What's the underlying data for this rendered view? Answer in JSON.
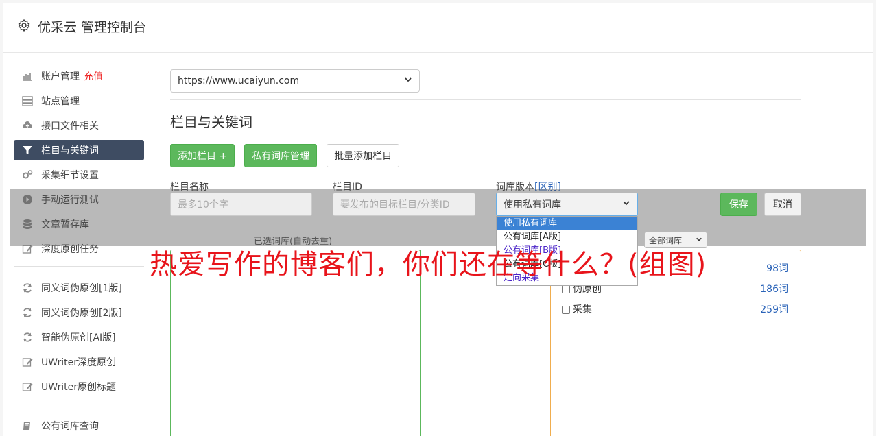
{
  "header": {
    "title": "优采云 管理控制台",
    "icon": "gear-icon"
  },
  "sidebar": {
    "items": [
      {
        "label": "账户管理",
        "badge": "充值",
        "icon": "bar-chart-icon"
      },
      {
        "label": "站点管理",
        "icon": "server-icon"
      },
      {
        "label": "接口文件相关",
        "icon": "cloud-upload-icon"
      },
      {
        "label": "栏目与关键词",
        "icon": "filter-icon",
        "active": true
      },
      {
        "label": "采集细节设置",
        "icon": "gears-icon"
      },
      {
        "label": "手动运行测试",
        "icon": "play-circle-icon"
      },
      {
        "label": "文章暂存库",
        "icon": "database-icon"
      },
      {
        "label": "深度原创任务",
        "icon": "edit-icon"
      }
    ],
    "items2": [
      {
        "label": "同义词伪原创[1版]",
        "icon": "refresh-icon"
      },
      {
        "label": "同义词伪原创[2版]",
        "icon": "refresh-icon"
      },
      {
        "label": "智能伪原创[AI版]",
        "icon": "refresh-icon"
      },
      {
        "label": "UWriter深度原创",
        "icon": "edit-icon"
      },
      {
        "label": "UWriter原创标题",
        "icon": "edit-icon"
      }
    ],
    "items3": [
      {
        "label": "公有词库查询",
        "icon": "book-icon"
      }
    ]
  },
  "main": {
    "site_select": "https://www.ucaiyun.com",
    "section_title": "栏目与关键词",
    "buttons": {
      "add_column": "添加栏目 +",
      "private_lib": "私有词库管理",
      "batch_add": "批量添加栏目"
    },
    "form": {
      "name_label": "栏目名称",
      "id_label": "栏目ID",
      "version_label": "词库版本",
      "version_link": "[区别]",
      "name_placeholder": "最多10个字",
      "id_placeholder": "要发布的目标栏目/分类ID",
      "version_value": "使用私有词库",
      "save": "保存",
      "cancel": "取消"
    },
    "version_options": [
      "使用私有词库",
      "公有词库[A版]",
      "公有词库[B版]",
      "公有词库[C版]",
      "定向采集"
    ],
    "selected_lib_label": "已选词库(自动去重)",
    "filter_select": "全部词库",
    "libraries": [
      {
        "name": "",
        "count": "98词"
      },
      {
        "name": "伪原创",
        "count": "186词"
      },
      {
        "name": "采集",
        "count": "259词"
      }
    ]
  },
  "watermark": "热爱写作的博客们，你们还在等什么？(组图)"
}
